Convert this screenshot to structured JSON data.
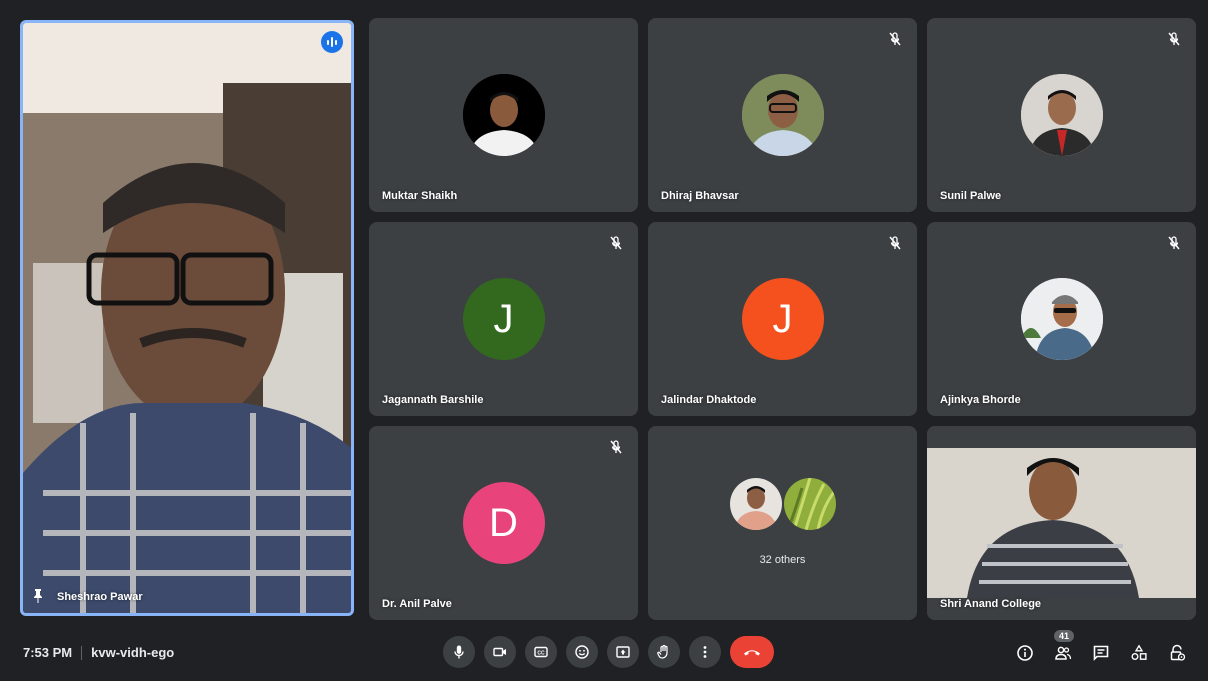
{
  "main_speaker": {
    "name": "Sheshrao Pawar"
  },
  "participants": [
    {
      "name": "Muktar Shaikh",
      "avatar": "photo"
    },
    {
      "name": "Dhiraj Bhavsar",
      "avatar": "photo"
    },
    {
      "name": "Sunil Palwe",
      "avatar": "photo"
    },
    {
      "name": "Jagannath Barshile",
      "avatar": "letter",
      "letter": "J",
      "color": "#33691e"
    },
    {
      "name": "Jalindar Dhaktode",
      "avatar": "letter",
      "letter": "J",
      "color": "#f4511e"
    },
    {
      "name": "Ajinkya Bhorde",
      "avatar": "photo"
    },
    {
      "name": "Dr. Anil Palve",
      "avatar": "letter",
      "letter": "D",
      "color": "#e8437b"
    },
    {
      "name": "Shri Anand College",
      "avatar": "video"
    }
  ],
  "others_tile": {
    "label": "32 others"
  },
  "meeting": {
    "time": "7:53 PM",
    "code": "kvw-vidh-ego"
  },
  "people_count": "41",
  "controls": [
    "mic-icon",
    "camera-icon",
    "captions-icon",
    "emoji-icon",
    "present-icon",
    "raise-hand-icon",
    "more-options-icon",
    "end-call-icon"
  ],
  "right_controls": [
    "info-icon",
    "people-icon",
    "chat-icon",
    "activities-icon",
    "host-controls-icon"
  ],
  "colors": {
    "accent": "#8ab4f8",
    "end_call": "#ea4335",
    "tile": "#3c4043",
    "background": "#202124"
  }
}
